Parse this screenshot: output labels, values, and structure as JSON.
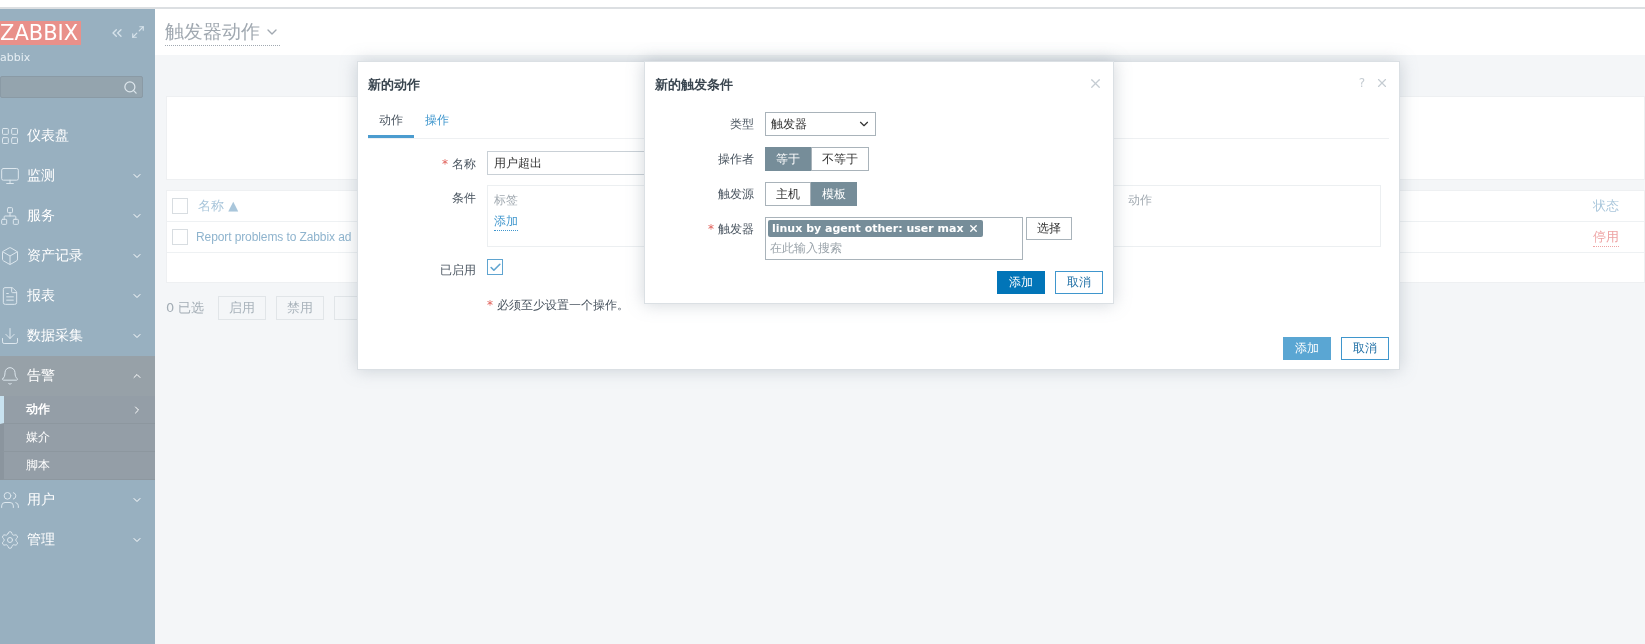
{
  "sidebar": {
    "logo": "ZABBIX",
    "subtitle": "abbix",
    "items": [
      {
        "label": "仪表盘",
        "kind": "link",
        "expanded": false
      },
      {
        "label": "监测",
        "kind": "menu",
        "expanded": false
      },
      {
        "label": "服务",
        "kind": "menu",
        "expanded": false
      },
      {
        "label": "资产记录",
        "kind": "menu",
        "expanded": false
      },
      {
        "label": "报表",
        "kind": "menu",
        "expanded": false
      },
      {
        "label": "数据采集",
        "kind": "menu",
        "expanded": false
      },
      {
        "label": "告警",
        "kind": "menu",
        "expanded": true,
        "children": [
          {
            "label": "动作",
            "selected": true
          },
          {
            "label": "媒介",
            "selected": false
          },
          {
            "label": "脚本",
            "selected": false
          }
        ]
      },
      {
        "label": "用户",
        "kind": "menu",
        "expanded": false
      },
      {
        "label": "管理",
        "kind": "menu",
        "expanded": false
      }
    ]
  },
  "page": {
    "title": "触发器动作",
    "table": {
      "all_checked": false,
      "columns": [
        {
          "label": "名称",
          "sort_mark": "▲"
        },
        {
          "label": "状态"
        }
      ],
      "rows": [
        {
          "name": "Report problems to Zabbix ad",
          "status": "停用",
          "checked": false
        }
      ]
    },
    "footer": {
      "count": "0 已选",
      "buttons": [
        "启用",
        "禁用"
      ]
    }
  },
  "action_dialog": {
    "title": "新的动作",
    "help": "?",
    "tabs": [
      {
        "label": "动作",
        "selected": true
      },
      {
        "label": "操作",
        "selected": false
      }
    ],
    "name_field": {
      "mark": "*",
      "label": "名称",
      "value": "用户超出"
    },
    "conditions": {
      "label": "条件",
      "columns": [
        "标签",
        "动作"
      ],
      "add_link": "添加"
    },
    "enabled": {
      "label": "已启用",
      "checked": true
    },
    "note": {
      "mark": "*",
      "text": "必须至少设置一个操作。"
    },
    "buttons": [
      {
        "label": "添加",
        "kind": "primary"
      },
      {
        "label": "取消",
        "kind": "secondary"
      }
    ]
  },
  "condition_dialog": {
    "title": "新的触发条件",
    "fields": [
      {
        "kind": "select",
        "label": "类型",
        "value": "触发器"
      },
      {
        "kind": "segmented",
        "label": "操作者",
        "options": [
          {
            "label": "等于",
            "selected": true
          },
          {
            "label": "不等于",
            "selected": false
          }
        ]
      },
      {
        "kind": "segmented",
        "label": "触发源",
        "options": [
          {
            "label": "主机",
            "selected": false
          },
          {
            "label": "模板",
            "selected": true
          }
        ]
      },
      {
        "kind": "multiselect",
        "mark": "*",
        "label": "触发器",
        "tags": [
          "linux by agent other: user max"
        ],
        "placeholder": "在此输入搜索",
        "button": "选择"
      }
    ],
    "buttons": [
      {
        "label": "添加",
        "kind": "primary"
      },
      {
        "label": "取消",
        "kind": "secondary"
      }
    ]
  }
}
